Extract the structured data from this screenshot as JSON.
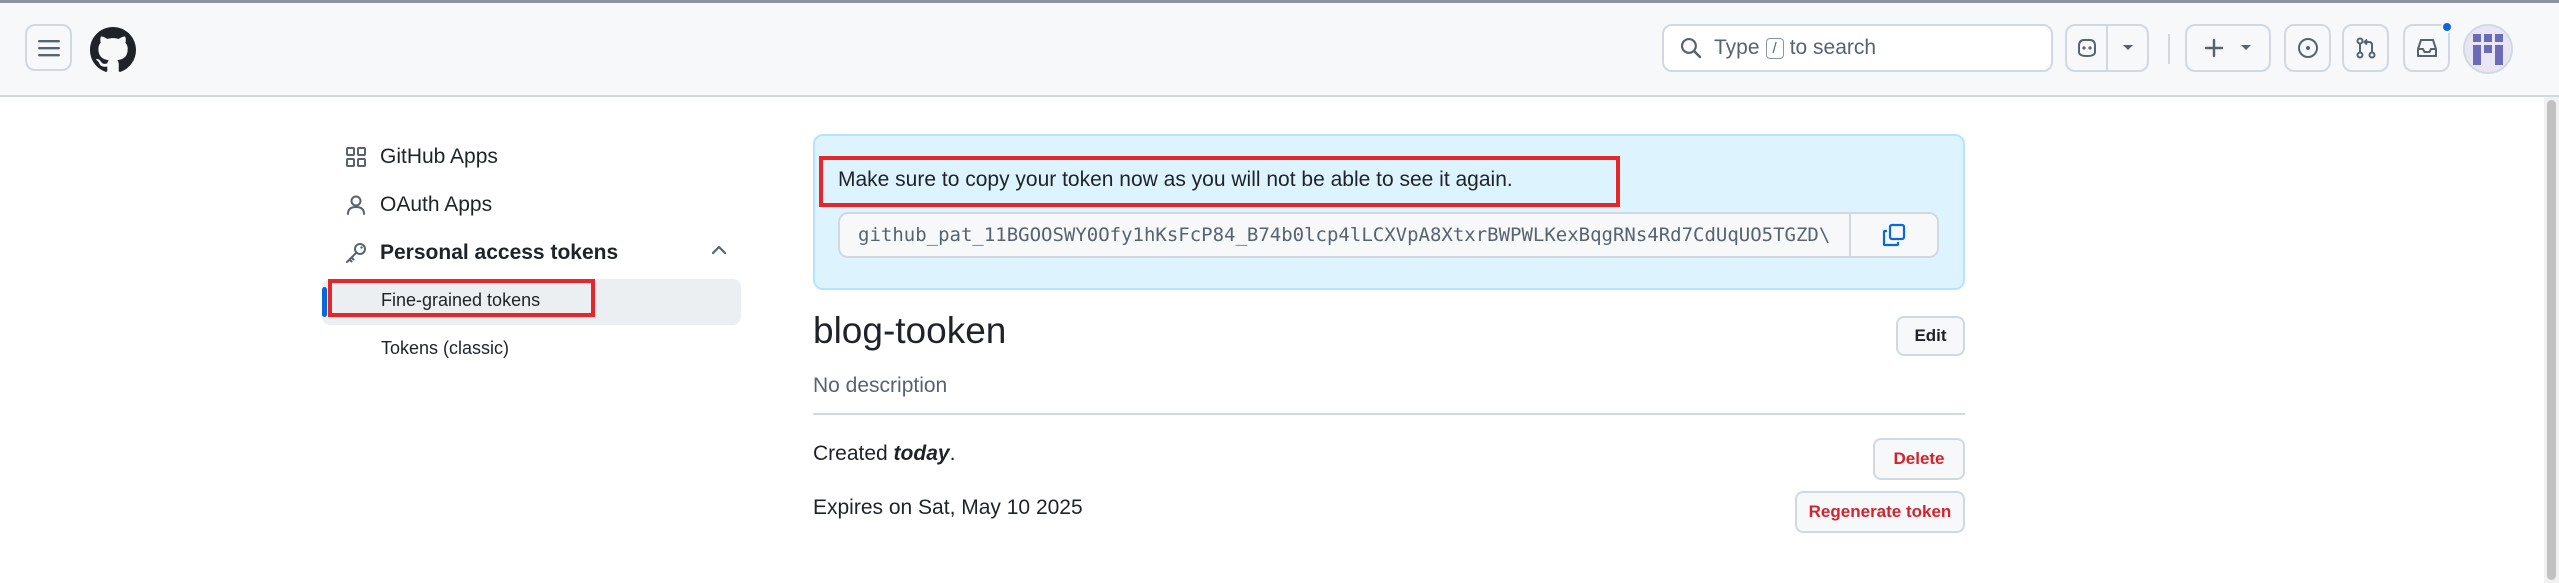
{
  "header": {
    "search": {
      "pre": "Type",
      "key": "/",
      "post": "to search"
    },
    "icons": [
      "hamburger-icon",
      "github-logo",
      "search-icon",
      "copilot-icon",
      "chevron-down-icon",
      "plus-icon",
      "issue-icon",
      "pull-request-icon",
      "inbox-icon",
      "avatar"
    ],
    "inbox_unread": true,
    "accent": "#0969da"
  },
  "sidebar": {
    "items": [
      {
        "label": "GitHub Apps",
        "icon": "apps-icon"
      },
      {
        "label": "OAuth Apps",
        "icon": "person-icon"
      },
      {
        "label": "Personal access tokens",
        "icon": "key-icon",
        "expanded": true
      }
    ],
    "subitems": [
      {
        "label": "Fine-grained tokens",
        "selected": true
      },
      {
        "label": "Tokens (classic)",
        "selected": false
      }
    ]
  },
  "flash": {
    "message": "Make sure to copy your token now as you will not be able to see it again.",
    "token": "github_pat_11BGOOSWY0Ofy1hKsFcP84_B74b0lcp4lLCXVpA8XtxrBWPWLKexBqgRNs4Rd7CdUqUO5TGZD\\"
  },
  "token_detail": {
    "name": "blog-tooken",
    "description": "No description",
    "created_prefix": "Created ",
    "created_value": "today",
    "created_suffix": ".",
    "expires": "Expires on Sat, May 10 2025",
    "edit_label": "Edit",
    "delete_label": "Delete",
    "regenerate_label": "Regenerate token"
  },
  "colors": {
    "danger": "#d1242f",
    "annotation": "#e5262b",
    "flash_bg": "#ddf4ff"
  }
}
